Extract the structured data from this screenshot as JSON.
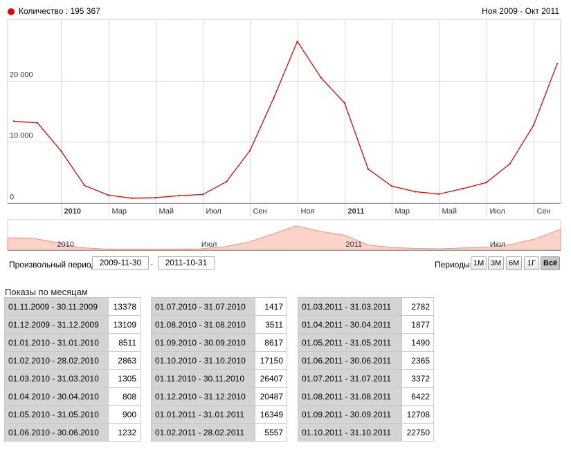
{
  "legend": {
    "label": "Количество : 195 367",
    "color": "#e60000"
  },
  "period_range": "Ноя 2009 - Окт 2011",
  "chart_data": {
    "type": "line",
    "x": [
      "2009-11",
      "2009-12",
      "2010-01",
      "2010-02",
      "2010-03",
      "2010-04",
      "2010-05",
      "2010-06",
      "2010-07",
      "2010-08",
      "2010-09",
      "2010-10",
      "2010-11",
      "2010-12",
      "2011-01",
      "2011-02",
      "2011-03",
      "2011-04",
      "2011-05",
      "2011-06",
      "2011-07",
      "2011-08",
      "2011-09",
      "2011-10"
    ],
    "series": [
      {
        "values": [
          13378,
          13109,
          8511,
          2863,
          1305,
          808,
          900,
          1232,
          1417,
          3511,
          8617,
          17150,
          26407,
          20487,
          16349,
          5557,
          2782,
          1877,
          1490,
          2365,
          3372,
          6422,
          12708,
          22750
        ]
      }
    ],
    "y_ticks": [
      {
        "value": 0,
        "label": "0"
      },
      {
        "value": 10000,
        "label": "10 000"
      },
      {
        "value": 20000,
        "label": "20 000"
      }
    ],
    "x_ticks": [
      {
        "index": 2,
        "label": "2010",
        "bold": true
      },
      {
        "index": 4,
        "label": "Мар",
        "bold": false
      },
      {
        "index": 6,
        "label": "Май",
        "bold": false
      },
      {
        "index": 8,
        "label": "Июл",
        "bold": false
      },
      {
        "index": 10,
        "label": "Сен",
        "bold": false
      },
      {
        "index": 12,
        "label": "Ноя",
        "bold": false
      },
      {
        "index": 14,
        "label": "2011",
        "bold": true
      },
      {
        "index": 16,
        "label": "Мар",
        "bold": false
      },
      {
        "index": 18,
        "label": "Май",
        "bold": false
      },
      {
        "index": 20,
        "label": "Июл",
        "bold": false
      },
      {
        "index": 22,
        "label": "Сен",
        "bold": false
      }
    ],
    "ylim": [
      0,
      30000
    ],
    "grid": true,
    "line_color": "#e60000"
  },
  "navigator": {
    "labels": [
      {
        "index": 2,
        "label": "2010"
      },
      {
        "index": 8,
        "label": "Июл"
      },
      {
        "index": 14,
        "label": "2011"
      },
      {
        "index": 20,
        "label": "Июл"
      }
    ],
    "fill": "#fbd3c8",
    "stroke": "#f08f80"
  },
  "controls": {
    "custom_period_label": "Произвольный период:",
    "date_from": "2009-11-30",
    "date_to": "2011-10-31",
    "separator": "-",
    "periods_label": "Периоды:",
    "buttons": [
      "1М",
      "3М",
      "6М",
      "1Г",
      "Всё"
    ],
    "active_button": "Всё"
  },
  "table": {
    "title": "Показы по месяцам",
    "columns": [
      [
        {
          "range": "01.11.2009 - 30.11.2009",
          "count": "13378"
        },
        {
          "range": "01.12.2009 - 31.12.2009",
          "count": "13109"
        },
        {
          "range": "01.01.2010 - 31.01.2010",
          "count": "8511"
        },
        {
          "range": "01.02.2010 - 28.02.2010",
          "count": "2863"
        },
        {
          "range": "01.03.2010 - 31.03.2010",
          "count": "1305"
        },
        {
          "range": "01.04.2010 - 30.04.2010",
          "count": "808"
        },
        {
          "range": "01.05.2010 - 31.05.2010",
          "count": "900"
        },
        {
          "range": "01.06.2010 - 30.06.2010",
          "count": "1232"
        }
      ],
      [
        {
          "range": "01.07.2010 - 31.07.2010",
          "count": "1417"
        },
        {
          "range": "01.08.2010 - 31.08.2010",
          "count": "3511"
        },
        {
          "range": "01.09.2010 - 30.09.2010",
          "count": "8617"
        },
        {
          "range": "01.10.2010 - 31.10.2010",
          "count": "17150"
        },
        {
          "range": "01.11.2010 - 30.11.2010",
          "count": "26407"
        },
        {
          "range": "01.12.2010 - 31.12.2010",
          "count": "20487"
        },
        {
          "range": "01.01.2011 - 31.01.2011",
          "count": "16349"
        },
        {
          "range": "01.02.2011 - 28.02.2011",
          "count": "5557"
        }
      ],
      [
        {
          "range": "01.03.2011 - 31.03.2011",
          "count": "2782"
        },
        {
          "range": "01.04.2011 - 30.04.2011",
          "count": "1877"
        },
        {
          "range": "01.05.2011 - 31.05.2011",
          "count": "1490"
        },
        {
          "range": "01.06.2011 - 30.06.2011",
          "count": "2365"
        },
        {
          "range": "01.07.2011 - 31.07.2011",
          "count": "3372"
        },
        {
          "range": "01.08.2011 - 31.08.2011",
          "count": "6422"
        },
        {
          "range": "01.09.2011 - 30.09.2011",
          "count": "12708"
        },
        {
          "range": "01.10.2011 - 31.10.2011",
          "count": "22750"
        }
      ]
    ]
  }
}
